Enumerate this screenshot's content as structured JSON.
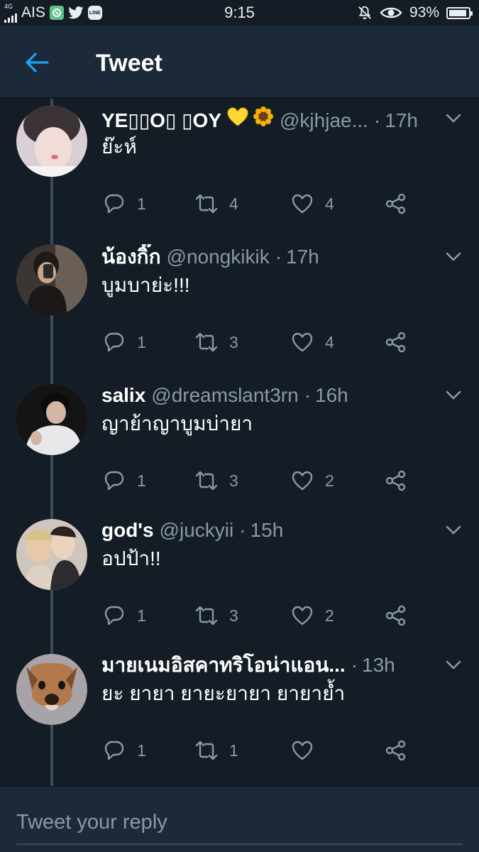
{
  "status_bar": {
    "network": "4G",
    "carrier": "AIS",
    "app_icons": [
      "green-app-icon",
      "twitter-icon",
      "line-icon"
    ],
    "line_label": "LINE",
    "time": "9:15",
    "battery": "93%",
    "battery_level": 0.93
  },
  "header": {
    "title": "Tweet",
    "accent_color": "#1da1f2"
  },
  "tweets": [
    {
      "name": "YE▯▯O▯ ▯OY",
      "name_emoji": [
        "yellow-heart-icon",
        "sunflower-icon"
      ],
      "handle": "@kjhjae...",
      "dot": "·",
      "time": "17h",
      "text": "ย๊ะห์",
      "replies": "1",
      "retweets": "4",
      "likes": "4"
    },
    {
      "name": "น้องกิ๊ก",
      "handle": "@nongkikik",
      "dot": "·",
      "time": "17h",
      "text": "บูมบาย่ะ!!!",
      "replies": "1",
      "retweets": "3",
      "likes": "4"
    },
    {
      "name": "salix",
      "handle": "@dreamslant3rn",
      "dot": "·",
      "time": "16h",
      "text": "ญาย้าญาบูมบ่ายา",
      "replies": "1",
      "retweets": "3",
      "likes": "2"
    },
    {
      "name": "god's",
      "handle": "@juckyii",
      "dot": "·",
      "time": "15h",
      "text": "อปป้า!!",
      "replies": "1",
      "retweets": "3",
      "likes": "2"
    },
    {
      "name": "มายเนมอิสคาทริโอน่าแอน...",
      "handle": "",
      "dot": "·",
      "time": "13h",
      "text": "ยะ ยายา ยายะยายา ยายายํ้า",
      "replies": "1",
      "retweets": "1",
      "likes": ""
    }
  ],
  "reply_bar": {
    "placeholder": "Tweet your reply"
  }
}
